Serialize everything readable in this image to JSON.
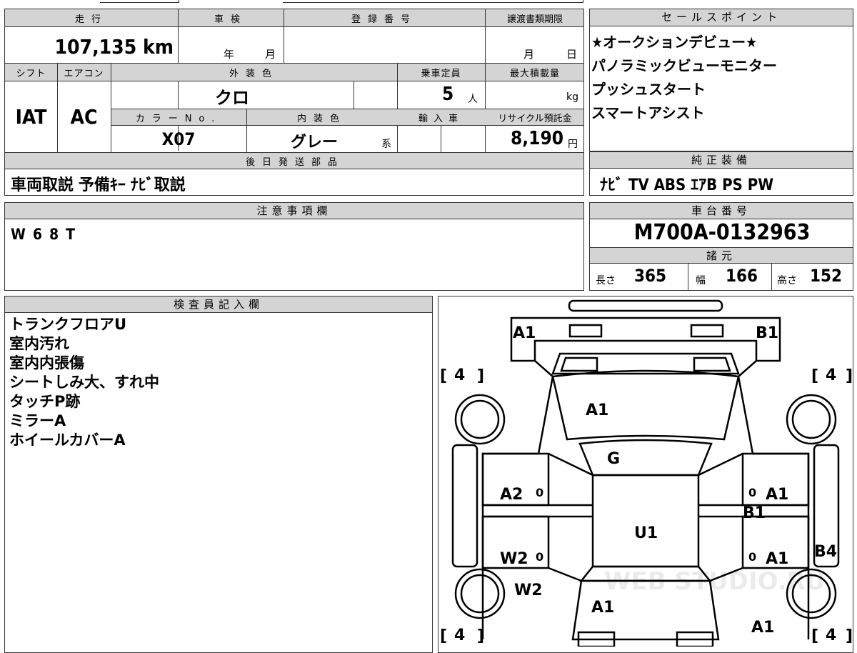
{
  "top_left_sheet": {
    "labels": {
      "mileage": "走行",
      "inspection": "車検",
      "reg_no": "登録番号",
      "transfer_deadline": "譲渡書類期限",
      "shift": "シフト",
      "aircon": "エアコン",
      "ext_color": "外装色",
      "capacity": "乗車定員",
      "max_load": "最大積載量",
      "color_no": "カラーNo.",
      "int_color": "内装色",
      "import": "輸入車",
      "recycle": "リサイクル預託金",
      "later_parts": "後日発送部品"
    },
    "values": {
      "mileage": "107,135 km",
      "year_unit": "年",
      "month_unit": "月",
      "deadline_month": "月",
      "deadline_day": "日",
      "shift": "IAT",
      "aircon": "AC",
      "ext_color": "クロ",
      "capacity": "5",
      "capacity_unit": "人",
      "load_unit": "kg",
      "color_no": "X07",
      "int_color": "グレー",
      "int_color_suffix": "系",
      "recycle": "8,190",
      "recycle_unit": "円",
      "later_parts": "車両取説 予備ｷｰ ﾅﾋﾞ取説"
    }
  },
  "sales_points": {
    "header": "セールスポイント",
    "items": [
      "★オークションデビュー★",
      "パノラミックビューモニター",
      "プッシュスタート",
      "スマートアシスト"
    ]
  },
  "genuine_equipment": {
    "header": "純正装備",
    "value": "ﾅﾋﾞ TV ABS ｴｱB PS PW"
  },
  "notes": {
    "header": "注意事項欄",
    "value": "W68T"
  },
  "chassis": {
    "header": "車台番号",
    "value": "M700A-0132963"
  },
  "specs": {
    "header": "諸元",
    "length_label": "長さ",
    "length": "365",
    "width_label": "幅",
    "width": "166",
    "height_label": "高さ",
    "height": "152"
  },
  "inspector": {
    "header": "検査員記入欄",
    "lines": [
      "トランクフロアU",
      "室内汚れ",
      "室内内張傷",
      "シートしみ大、すれ中",
      "タッチP跡",
      "ミラーA",
      "ホイールカバーA"
    ]
  },
  "diagram": {
    "marks": {
      "front_left_corner": "A1",
      "front_right_corner": "B1",
      "hood": "A1",
      "windshield": "G",
      "left_front_door": "A2",
      "left_rear_door": "W2",
      "right_front_door": "A1",
      "right_mid": "B1",
      "right_rear_door": "A1",
      "roof": "U1",
      "right_rear_quarter": "B4",
      "left_rear_quarter": "W2",
      "rear_panel": "A1",
      "rear_right_corner": "A1"
    },
    "tire_front_left": "4",
    "tire_front_right": "4",
    "tire_rear_left": "4",
    "tire_rear_right": "4",
    "zero_mark": "0",
    "watermark": "WEB STUDIO.RU"
  }
}
